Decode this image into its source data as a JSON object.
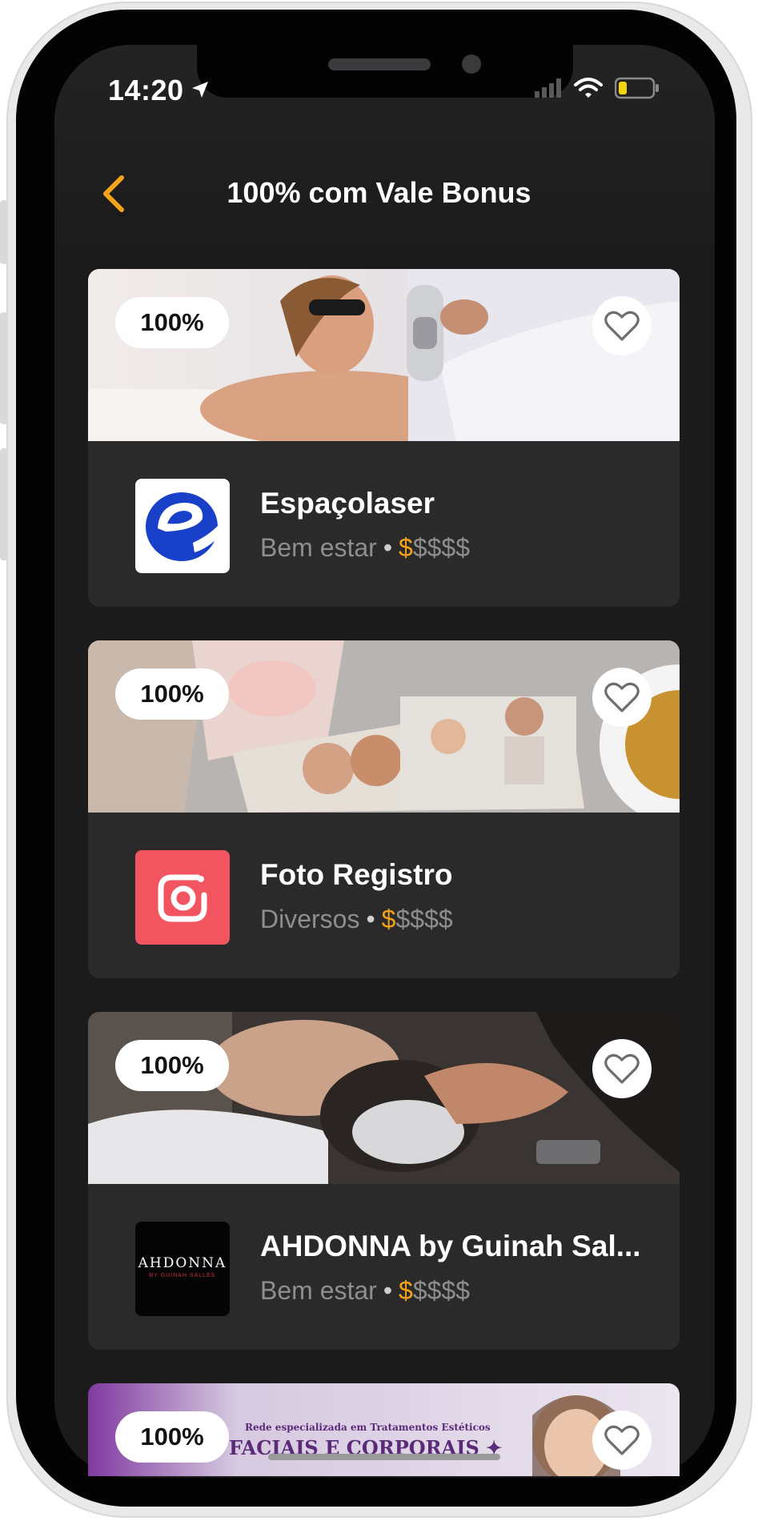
{
  "status_bar": {
    "time": "14:20",
    "icons": [
      "location-arrow-icon",
      "signal-icon",
      "wifi-icon",
      "battery-icon"
    ],
    "battery_color": "#f5d40f"
  },
  "header": {
    "back_icon": "chevron-left-icon",
    "title": "100% com Vale Bonus",
    "accent_color": "#f4a21a"
  },
  "cards": [
    {
      "badge": "100%",
      "name": "Espaçolaser",
      "category": "Bem estar",
      "price_active": "$",
      "price_inactive": "$$$$",
      "image": "laser-treatment-photo",
      "logo": "espacolaser-logo"
    },
    {
      "badge": "100%",
      "name": "Foto Registro",
      "category": "Diversos",
      "price_active": "$",
      "price_inactive": "$$$$",
      "image": "family-photos-collage",
      "logo": "camera-logo",
      "logo_color": "#f2555f"
    },
    {
      "badge": "100%",
      "name": "AHDONNA by Guinah Sal...",
      "category": "Bem estar",
      "price_active": "$",
      "price_inactive": "$$$$",
      "image": "hair-wash-photo",
      "logo": "ahdonna-logo",
      "logo_text": "AHDONNA",
      "logo_subtext": "BY GUINAH SALLES"
    },
    {
      "badge": "100%",
      "image": "facial-treatment-banner",
      "banner_small": "Rede especializada em Tratamentos Estéticos",
      "banner_large": "FACIAIS E CORPORAIS ✦"
    }
  ]
}
